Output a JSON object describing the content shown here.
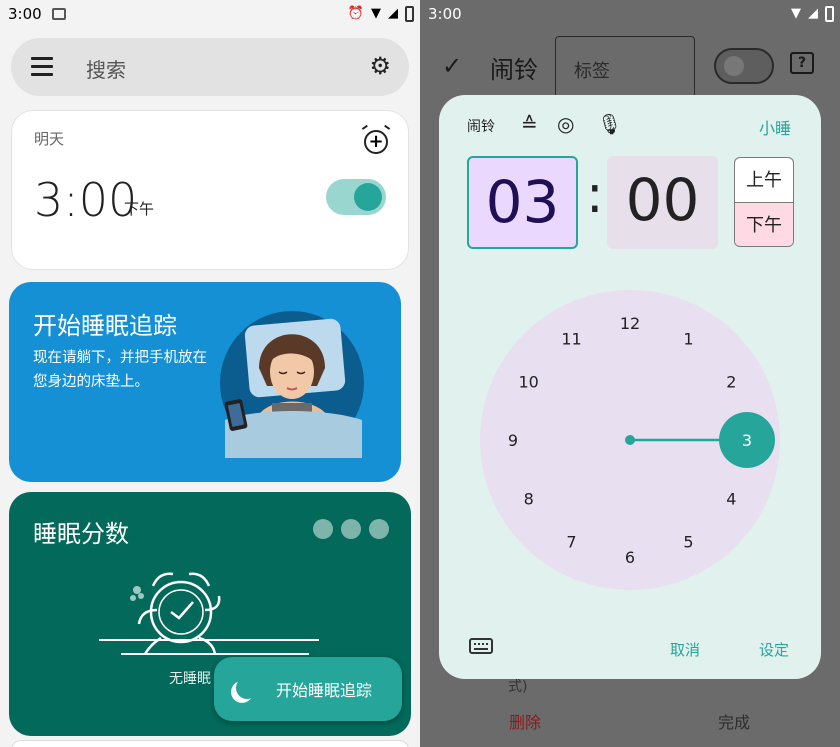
{
  "left": {
    "status": {
      "time": "3:00"
    },
    "search": {
      "placeholder": "搜索",
      "menu_icon": "menu-icon",
      "settings_icon": "gear-icon"
    },
    "alarm": {
      "day": "明天",
      "time": "3:00",
      "ampm": "下午",
      "enabled": true,
      "add_icon": "alarm-add-icon"
    },
    "sleep_tracking": {
      "title": "开始睡眠追踪",
      "description": "现在请躺下，并把手机放在您身边的床垫上。"
    },
    "sleep_score": {
      "title": "睡眠分数",
      "no_data": "无睡眠"
    },
    "fab": {
      "label": "开始睡眠追踪",
      "icon": "moon-icon"
    }
  },
  "right": {
    "status": {
      "time": "3:00"
    },
    "topbar": {
      "title": "闹铃",
      "label_field": "标签",
      "help_icon": "help-icon"
    },
    "dialog": {
      "tab_label": "闹铃",
      "icons": [
        "sunrise-icon",
        "target-icon",
        "mic-icon"
      ],
      "nap": "小睡",
      "hour": "03",
      "minute": "00",
      "am": "上午",
      "pm": "下午",
      "selected_period": "pm",
      "dial_numbers": [
        "12",
        "1",
        "2",
        "3",
        "4",
        "5",
        "6",
        "7",
        "8",
        "9",
        "10",
        "11"
      ],
      "selected_hour": 3,
      "cancel": "取消",
      "ok": "设定"
    },
    "underlay": {
      "fragment": "式)",
      "delete": "删除",
      "done": "完成"
    }
  },
  "colors": {
    "accent": "#26a69a",
    "sleep_card": "#1590d4",
    "score_card": "#03695a",
    "dial_bg": "#e8dff0"
  }
}
